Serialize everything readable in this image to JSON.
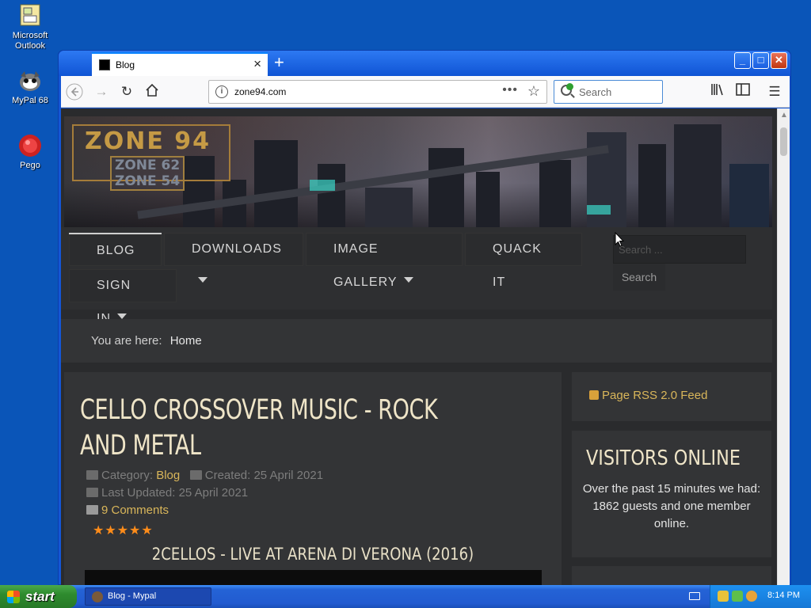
{
  "desktop": {
    "icons": [
      {
        "label": "Microsoft Outlook"
      },
      {
        "label": "MyPal 68"
      },
      {
        "label": "Pego"
      }
    ]
  },
  "browser": {
    "tab_title": "Blog",
    "url": "zone94.com",
    "search_placeholder": "Search"
  },
  "site": {
    "logo_main": "ZONE 94",
    "logo_sub1": "ZONE 62",
    "logo_sub2": "ZONE 54",
    "menu": [
      {
        "label": "BLOG",
        "dropdown": true
      },
      {
        "label": "DOWNLOADS",
        "dropdown": true
      },
      {
        "label": "IMAGE GALLERY",
        "dropdown": true
      },
      {
        "label": "QUACK IT",
        "dropdown": false
      },
      {
        "label": "SIGN IN",
        "dropdown": true
      }
    ],
    "search_placeholder": "Search ...",
    "search_button": "Search",
    "breadcrumb_prefix": "You are here:",
    "breadcrumb_home": "Home",
    "article": {
      "title": "CELLO CROSSOVER MUSIC - ROCK AND METAL",
      "category_label": "Category:",
      "category": "Blog",
      "created": "Created: 25 April 2021",
      "updated": "Last Updated: 25 April 2021",
      "comments": "9 Comments",
      "rating": 5,
      "video_title": "2CELLOS - LIVE AT ARENA DI VERONA (2016)"
    },
    "sidebar": {
      "rss": "Page RSS 2.0 Feed",
      "visitors_title": "VISITORS ONLINE",
      "visitors_line1": "Over the past 15 minutes we had:",
      "visitors_line2": "1862 guests and one member online."
    }
  },
  "taskbar": {
    "start": "start",
    "task": "Blog - Mypal",
    "clock": "8:14 PM"
  }
}
